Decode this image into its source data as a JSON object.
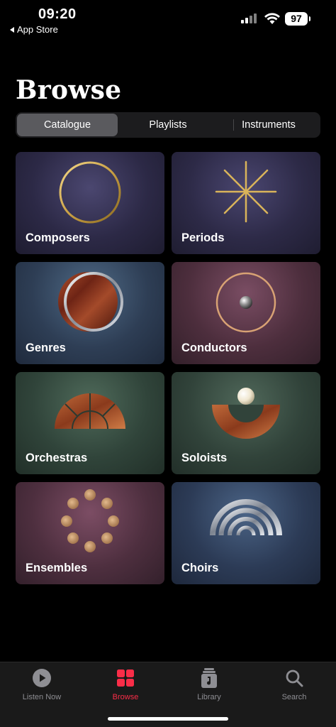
{
  "status_bar": {
    "time": "09:20",
    "back_label": "App Store",
    "battery": "97"
  },
  "page": {
    "title": "Browse"
  },
  "segments": [
    {
      "label": "Catalogue",
      "selected": true
    },
    {
      "label": "Playlists",
      "selected": false
    },
    {
      "label": "Instruments",
      "selected": false
    }
  ],
  "categories": [
    {
      "label": "Composers",
      "icon": "gold-ring-icon"
    },
    {
      "label": "Periods",
      "icon": "gold-star-burst-icon"
    },
    {
      "label": "Genres",
      "icon": "wood-disc-icon"
    },
    {
      "label": "Conductors",
      "icon": "ring-with-sphere-icon"
    },
    {
      "label": "Orchestras",
      "icon": "wood-fan-icon"
    },
    {
      "label": "Soloists",
      "icon": "sphere-on-arc-icon"
    },
    {
      "label": "Ensembles",
      "icon": "circle-of-dots-icon"
    },
    {
      "label": "Choirs",
      "icon": "silver-arches-icon"
    }
  ],
  "tab_bar": {
    "items": [
      {
        "label": "Listen Now",
        "icon": "play-circle-icon",
        "active": false
      },
      {
        "label": "Browse",
        "icon": "grid-icon",
        "active": true
      },
      {
        "label": "Library",
        "icon": "music-stack-icon",
        "active": false
      },
      {
        "label": "Search",
        "icon": "search-icon",
        "active": false
      }
    ]
  },
  "colors": {
    "accent": "#fa2d48",
    "background": "#000000",
    "tab_bar": "#1a1a1a"
  }
}
